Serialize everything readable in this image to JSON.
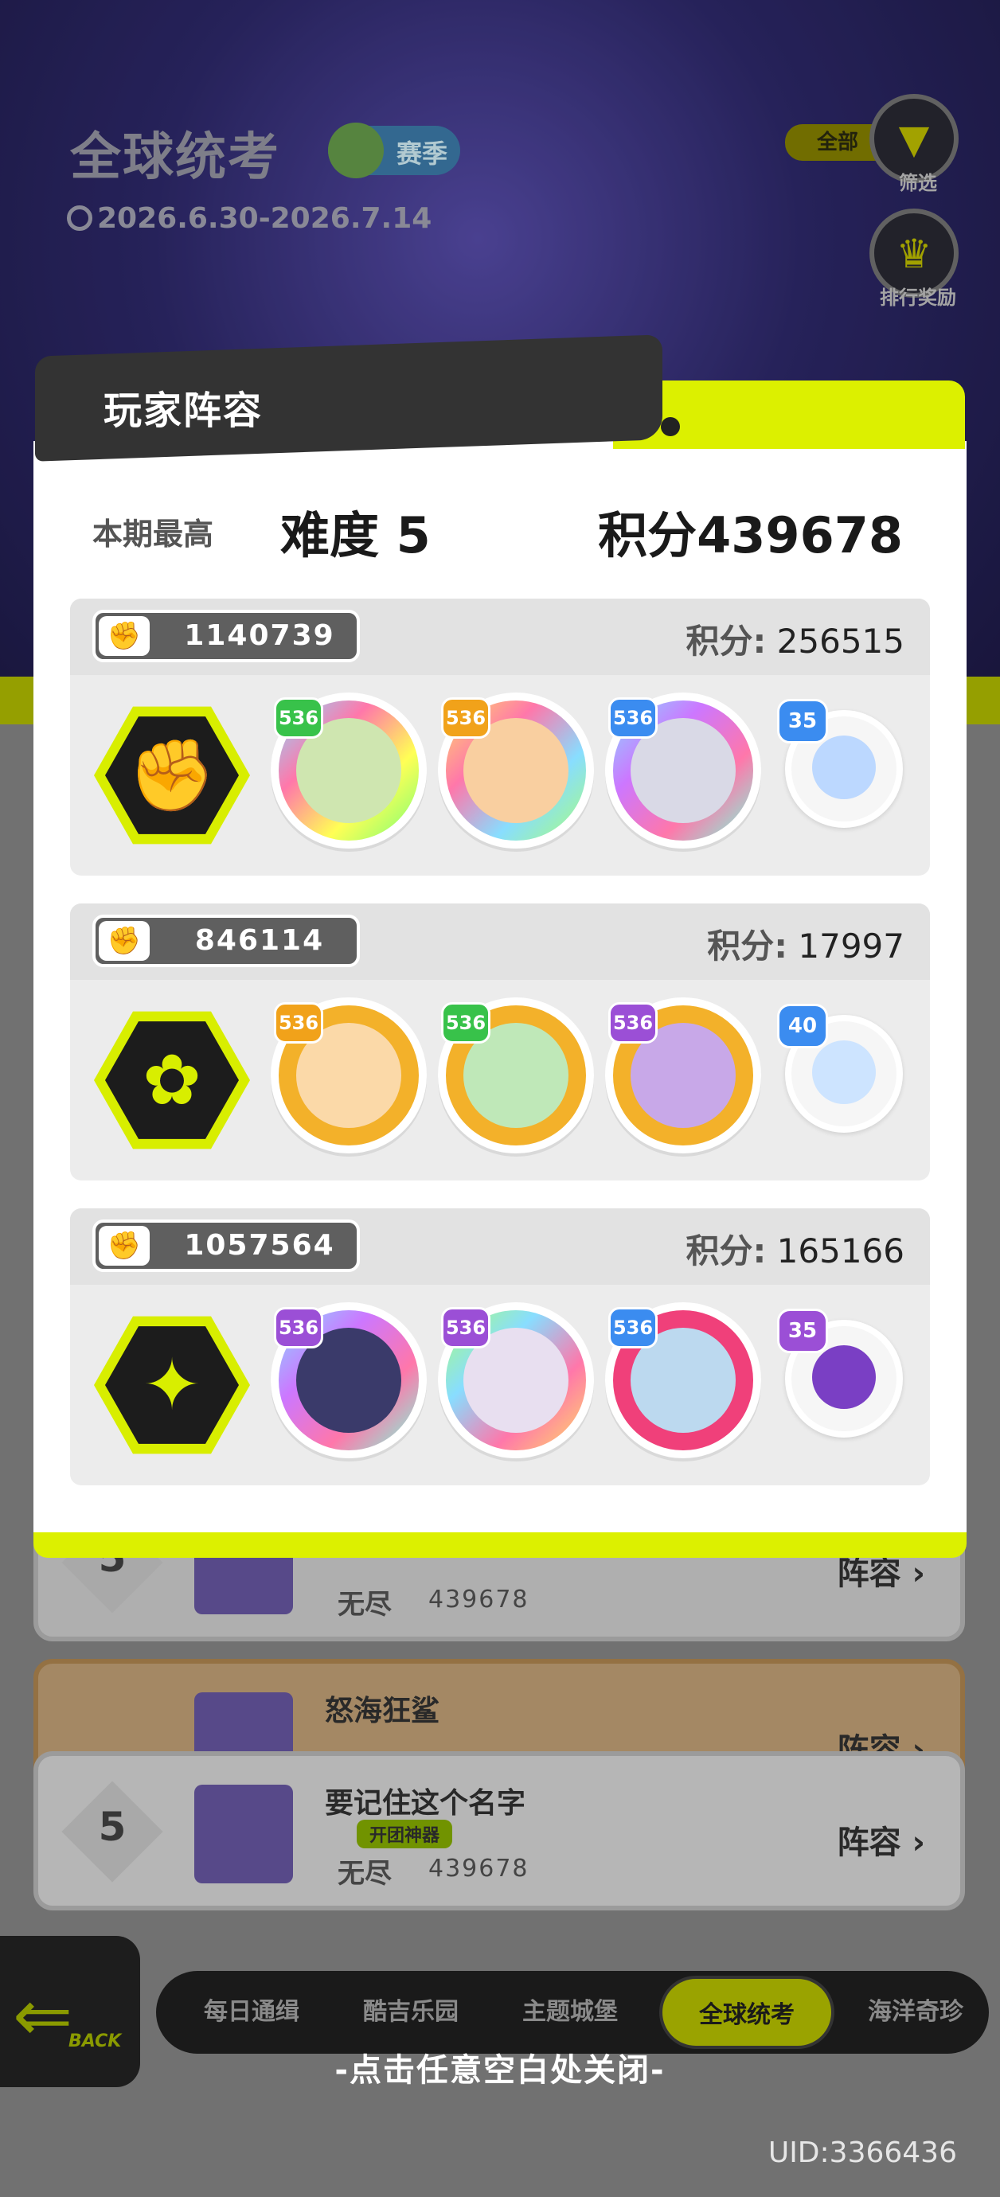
{
  "header": {
    "title": "全球统考",
    "season_label": "赛季",
    "date_range": "2026.6.30-2026.7.14",
    "filter_tag": "全部",
    "filter_button": "筛选",
    "ranking_reward_button": "排行奖励"
  },
  "modal": {
    "title": "玩家阵容",
    "best_label": "本期最高",
    "best_difficulty": "难度 5",
    "best_score": "积分439678",
    "score_key": "积分:",
    "teams": [
      {
        "id": "1140739",
        "score": "256515",
        "heroes": [
          {
            "level": "536"
          },
          {
            "level": "536"
          },
          {
            "level": "536"
          }
        ],
        "pet_level": "35"
      },
      {
        "id": "846114",
        "score": "17997",
        "heroes": [
          {
            "level": "536"
          },
          {
            "level": "536"
          },
          {
            "level": "536"
          }
        ],
        "pet_level": "40"
      },
      {
        "id": "1057564",
        "score": "165166",
        "heroes": [
          {
            "level": "536"
          },
          {
            "level": "536"
          },
          {
            "level": "536"
          }
        ],
        "pet_level": "35"
      }
    ]
  },
  "leaderboard": {
    "rows": [
      {
        "rank": "5",
        "name": "",
        "mode": "无尽",
        "points": "439678",
        "lineup": "阵容"
      },
      {
        "rank": "",
        "name": "怒海狂鲨",
        "mode": "",
        "points": "",
        "lineup": "阵容"
      },
      {
        "rank": "5",
        "name": "要记住这个名字",
        "tag": "开团神器",
        "mode": "无尽",
        "points": "439678",
        "lineup": "阵容"
      }
    ]
  },
  "nav": {
    "back_label": "BACK",
    "tabs": [
      "每日通缉",
      "酷吉乐园",
      "主题城堡",
      "全球统考",
      "海洋奇珍"
    ],
    "active_tab": "全球统考"
  },
  "close_hint": "-点击任意空白处关闭-",
  "uid": "UID:3366436",
  "colors": {
    "accent_lime": "#dcf000",
    "modal_header": "#333333",
    "level_green": "#38c24a",
    "level_orange": "#f1a21a",
    "level_purple": "#9b4fd6",
    "pet_blue": "#3b8cf0"
  }
}
